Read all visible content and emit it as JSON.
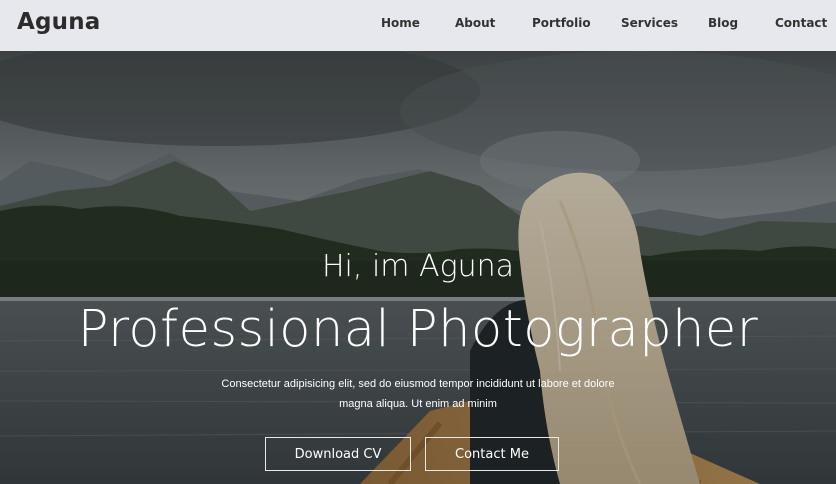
{
  "brand": "Aguna",
  "nav": {
    "items": [
      {
        "label": "Home"
      },
      {
        "label": "About"
      },
      {
        "label": "Portfolio"
      },
      {
        "label": "Services"
      },
      {
        "label": "Blog"
      },
      {
        "label": "Contact"
      }
    ]
  },
  "hero": {
    "greeting": "Hi, im Aguna",
    "title": "Professional Photographer",
    "description_line1": "Consectetur adipisicing elit, sed do eiusmod tempor incididunt ut labore et dolore",
    "description_line2": "magna aliqua. Ut enim ad minim",
    "buttons": {
      "download_cv": "Download CV",
      "contact_me": "Contact Me"
    }
  },
  "colors": {
    "navbar_bg": "#e6e8ee",
    "text_dark": "#2c2c2c",
    "hero_text": "#ffffff"
  }
}
